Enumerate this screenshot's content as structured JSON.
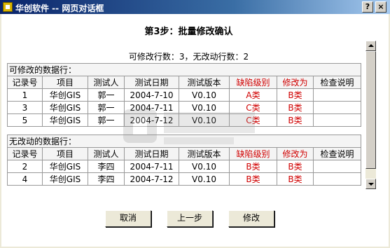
{
  "window": {
    "title": "华创软件 -- 网页对话框",
    "help_label": "?",
    "close_label": "×"
  },
  "step_title": "第3步：批量修改确认",
  "summary": "可修改行数：3，无改动行数：2",
  "modifiable": {
    "section_label": "可修改的数据行：",
    "headers": [
      "记录号",
      "项目",
      "测试人",
      "测试日期",
      "测试版本",
      "缺陷级别",
      "修改为",
      "检查说明"
    ],
    "rows": [
      [
        "1",
        "华创GIS",
        "郭一",
        "2004-7-10",
        "V0.10",
        "A类",
        "B类",
        ""
      ],
      [
        "3",
        "华创GIS",
        "郭一",
        "2004-7-11",
        "V0.10",
        "C类",
        "B类",
        ""
      ],
      [
        "5",
        "华创GIS",
        "郭一",
        "2004-7-12",
        "V0.10",
        "C类",
        "B类",
        ""
      ]
    ]
  },
  "unchanged": {
    "section_label": "无改动的数据行：",
    "headers": [
      "记录号",
      "项目",
      "测试人",
      "测试日期",
      "测试版本",
      "缺陷级别",
      "修改为",
      "检查说明"
    ],
    "rows": [
      [
        "2",
        "华创GIS",
        "李四",
        "2004-7-11",
        "V0.10",
        "B类",
        "B类",
        ""
      ],
      [
        "4",
        "华创GIS",
        "李四",
        "2004-7-12",
        "V0.10",
        "B类",
        "B类",
        ""
      ]
    ]
  },
  "buttons": {
    "cancel": "取消",
    "prev": "上一步",
    "modify": "修改"
  },
  "colors": {
    "title_bar": "#0a246a",
    "highlight_text": "#d00000"
  }
}
